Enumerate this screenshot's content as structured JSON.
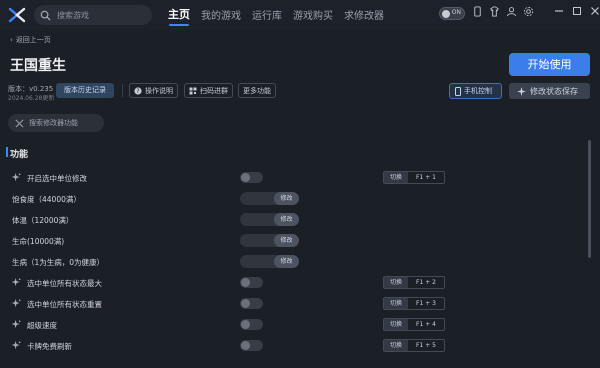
{
  "topbar": {
    "search_placeholder": "搜索游戏",
    "nav": [
      "主页",
      "我的游戏",
      "运行库",
      "游戏购买",
      "求修改器"
    ],
    "toggle_text": "ON"
  },
  "header": {
    "back_label": "返回上一页",
    "game_title": "王国重生",
    "version": "版本：v0.235",
    "version_date": "2024.06.28更新",
    "history_button": "版本历史记录",
    "instructions_button": "操作说明",
    "scan_button": "扫码进群",
    "more_button": "更多功能",
    "start_button": "开始使用",
    "phone_button": "手机控制",
    "save_button": "修改状态保存"
  },
  "function_search_placeholder": "搜索修改器功能",
  "section_title": "功能",
  "hotkey_switch_label": "切换",
  "slider_button_label": "修改",
  "features": [
    {
      "label": "开启选中单位修改",
      "type": "toggle",
      "hotkey": "F1 + 1",
      "sparkle": true
    },
    {
      "label": "饱食度（44000满）",
      "type": "slider",
      "sparkle": false
    },
    {
      "label": "体温（12000满）",
      "type": "slider",
      "sparkle": false
    },
    {
      "label": "生命(10000满)",
      "type": "slider",
      "sparkle": false
    },
    {
      "label": "生病（1为生病，0为健康）",
      "type": "slider",
      "sparkle": false
    },
    {
      "label": "选中单位所有状态最大",
      "type": "toggle",
      "hotkey": "F1 + 2",
      "sparkle": true
    },
    {
      "label": "选中单位所有状态重置",
      "type": "toggle",
      "hotkey": "F1 + 3",
      "sparkle": true
    },
    {
      "label": "超级速度",
      "type": "toggle",
      "hotkey": "F1 + 4",
      "sparkle": true
    },
    {
      "label": "卡牌免费刷新",
      "type": "toggle",
      "hotkey": "F1 + 5",
      "sparkle": true
    }
  ],
  "colors": {
    "accent": "#3b7de9",
    "background": "#1b1f26"
  }
}
